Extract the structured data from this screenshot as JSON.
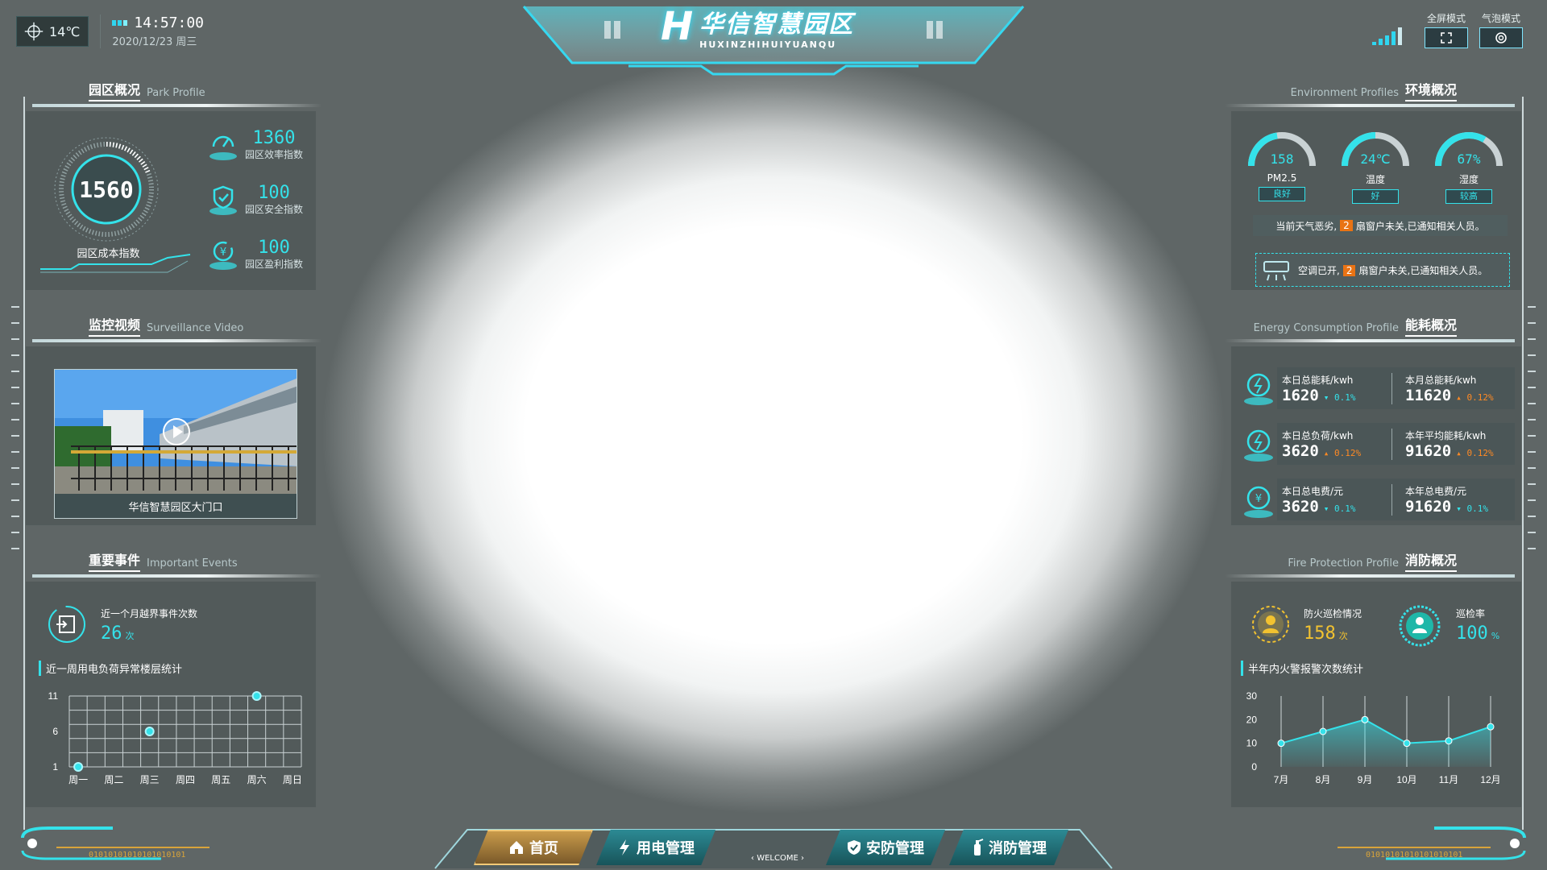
{
  "header": {
    "temperature": "14℃",
    "time": "14:57:00",
    "date": "2020/12/23  周三",
    "brand_letter": "H",
    "title": "华信智慧园区",
    "subtitle": "HUXINZHIHUIYUANQU",
    "modes": [
      {
        "label": "全屏模式",
        "icon": "fullscreen-icon"
      },
      {
        "label": "气泡模式",
        "icon": "bubble-icon"
      }
    ]
  },
  "park": {
    "title": "园区概况",
    "title_en": "Park Profile",
    "main_value": "1560",
    "main_label": "园区成本指数",
    "metrics": [
      {
        "value": "1360",
        "label": "园区效率指数",
        "icon": "speedometer-icon"
      },
      {
        "value": "100",
        "label": "园区安全指数",
        "icon": "shield-check-icon"
      },
      {
        "value": "100",
        "label": "园区盈利指数",
        "icon": "yen-cycle-icon"
      }
    ]
  },
  "video": {
    "title": "监控视频",
    "title_en": "Surveillance Video",
    "caption": "华信智慧园区大门口"
  },
  "events": {
    "title": "重要事件",
    "title_en": "Important Events",
    "stat_label": "近一个月越界事件次数",
    "stat_value": "26",
    "stat_unit": "次",
    "chart_title": "近一周用电负荷异常楼层统计"
  },
  "environment": {
    "title": "环境概况",
    "title_en": "Environment Profiles",
    "gauges": [
      {
        "value": "158",
        "label": "PM2.5",
        "status": "良好",
        "percent": 0.45
      },
      {
        "value": "24℃",
        "label": "温度",
        "status": "好",
        "percent": 0.5
      },
      {
        "value": "67%",
        "label": "湿度",
        "status": "较高",
        "percent": 0.67
      }
    ],
    "alert1_pre": "当前天气恶劣,",
    "alert1_num": "2",
    "alert1_post": "扇窗户未关,已通知相关人员。",
    "alert2_pre": "空调已开,",
    "alert2_num": "2",
    "alert2_post": "扇窗户未关,已通知相关人员。"
  },
  "energy": {
    "title": "能耗概况",
    "title_en": "Energy Consumption Profile",
    "rows": [
      [
        {
          "label": "本日总能耗/kwh",
          "value": "1620",
          "delta": "0.1%",
          "dir": "down"
        },
        {
          "label": "本月总能耗/kwh",
          "value": "11620",
          "delta": "0.12%",
          "dir": "up"
        }
      ],
      [
        {
          "label": "本日总负荷/kwh",
          "value": "3620",
          "delta": "0.12%",
          "dir": "up"
        },
        {
          "label": "本年平均能耗/kwh",
          "value": "91620",
          "delta": "0.12%",
          "dir": "up"
        }
      ],
      [
        {
          "label": "本日总电费/元",
          "value": "3620",
          "delta": "0.1%",
          "dir": "down"
        },
        {
          "label": "本年总电费/元",
          "value": "91620",
          "delta": "0.1%",
          "dir": "down"
        }
      ]
    ]
  },
  "fire": {
    "title": "消防概况",
    "title_en": "Fire Protection Profile",
    "patrol_label": "防火巡检情况",
    "patrol_value": "158",
    "patrol_unit": "次",
    "rate_label": "巡检率",
    "rate_value": "100",
    "rate_unit": "%",
    "chart_title": "半年内火警报警次数统计"
  },
  "nav": {
    "items": [
      {
        "label": "首页",
        "icon": "home-icon"
      },
      {
        "label": "用电管理",
        "icon": "lightning-icon"
      },
      {
        "label": "安防管理",
        "icon": "shield-icon"
      },
      {
        "label": "消防管理",
        "icon": "fire-extinguisher-icon"
      }
    ],
    "welcome": "WELCOME",
    "binary": "01010101010101010101"
  },
  "colors": {
    "accent": "#34e2ea",
    "warning": "#e97314",
    "gold": "#f2c230"
  },
  "chart_data": [
    {
      "type": "scatter",
      "title": "近一周用电负荷异常楼层统计",
      "categories": [
        "周一",
        "周二",
        "周三",
        "周四",
        "周五",
        "周六",
        "周日"
      ],
      "y_ticks": [
        1,
        6,
        11
      ],
      "ylim": [
        1,
        11
      ],
      "points": [
        {
          "x": "周一",
          "y": 1
        },
        {
          "x": "周三",
          "y": 6
        },
        {
          "x": "周六",
          "y": 11
        }
      ],
      "grid": true
    },
    {
      "type": "line",
      "title": "半年内火警报警次数统计",
      "categories": [
        "7月",
        "8月",
        "9月",
        "10月",
        "11月",
        "12月"
      ],
      "values": [
        10,
        15,
        20,
        10,
        11,
        17
      ],
      "y_ticks": [
        0,
        10,
        20,
        30
      ],
      "ylim": [
        0,
        30
      ],
      "grid": false
    }
  ]
}
